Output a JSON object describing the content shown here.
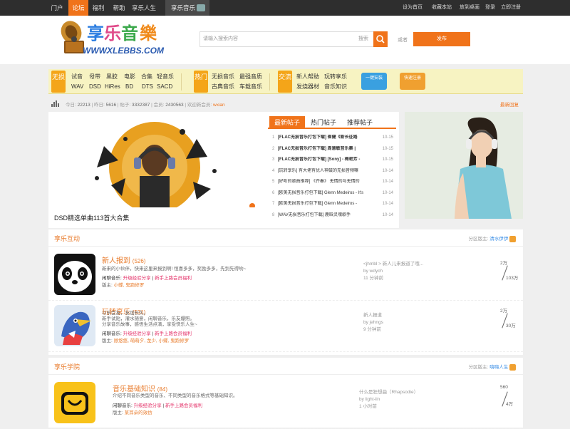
{
  "topnav": {
    "items": [
      "门户",
      "论坛",
      "福利",
      "帮助",
      "享乐人生"
    ],
    "active_index": 1,
    "music_tab": "享乐音乐",
    "right": [
      "设为首页",
      "收藏本站",
      "放到桌面",
      "登录",
      "立即注册"
    ]
  },
  "logo": {
    "cn": "享乐音樂",
    "url": "WWW.XLEBBS.COM"
  },
  "search": {
    "placeholder": "请输入搜索内容",
    "keyword": "搜索",
    "or_text": "或者",
    "post_button": "发布"
  },
  "categories": {
    "group1": {
      "label": "无损",
      "links": [
        "试音",
        "母带",
        "黑胶",
        "电影",
        "合集",
        "轻音乐",
        "WAV",
        "DSD",
        "HiRes",
        "BD",
        "DTS",
        "SACD"
      ]
    },
    "group2": {
      "label": "热门",
      "links": [
        "无损音乐",
        "最强音质",
        "古典音乐",
        "车载音乐"
      ]
    },
    "group3": {
      "label": "交流",
      "links": [
        "新人帮助",
        "玩转享乐",
        "发烧器材",
        "音乐知识"
      ]
    },
    "btn1": "一键安装",
    "btn2": "快速注册"
  },
  "stats": {
    "today_label": "今日:",
    "today": "22213",
    "yesterday_label": "昨日:",
    "yesterday": "5616",
    "posts_label": "帖子:",
    "posts": "3332387",
    "members_label": "会员:",
    "members": "2430563",
    "welcome_label": "欢迎新会员:",
    "welcome_user": "wxian",
    "latest": "最新回复"
  },
  "slider": {
    "caption": "DSD精选单曲113首大合集"
  },
  "hot": {
    "tabs": [
      "最新帖子",
      "热门帖子",
      "推荐帖子"
    ],
    "rows": [
      {
        "n": "1",
        "title": "[FLAC无损音乐打包下载] 崔健《新长征路",
        "date": "10-15",
        "bold": true
      },
      {
        "n": "2",
        "title": "[FLAC无损音乐打包下载] 周慧敏音乐集 |",
        "date": "10-15",
        "bold": true
      },
      {
        "n": "3",
        "title": "[FLAC无损音乐打包下载] [Sony] - 梅艳芳 -",
        "date": "10-15",
        "bold": true
      },
      {
        "n": "4",
        "title": "[玩转享乐] 有大佬有优人神鼓的无损音频嘛",
        "date": "10-14",
        "bold": false
      },
      {
        "n": "5",
        "title": "[好听的歌曲推荐] 《齐秦》 无情的与无情的",
        "date": "10-14",
        "bold": false
      },
      {
        "n": "6",
        "title": "[欧美无损音乐打包下载] Glenn Medeiros - It's",
        "date": "10-14",
        "bold": false
      },
      {
        "n": "7",
        "title": "[欧美无损音乐打包下载] Glenn Medeiros -",
        "date": "10-14",
        "bold": false
      },
      {
        "n": "8",
        "title": "[WAV无损音乐打包下载] 鹿晗灵魂歌手",
        "date": "10-14",
        "bold": false
      }
    ]
  },
  "sections": [
    {
      "title": "享乐互动",
      "mod_label": "分区版主:",
      "mod_name": "清水伊伊",
      "forums": [
        {
          "name": "新人报到",
          "count": "(526)",
          "desc": [
            "新来的小伙伴，快来这里来报到啊! 恒喜多多，奖励多多，先到先得哟~"
          ],
          "idle_label": "闲聊音乐:",
          "idle_a": "升级经验分享",
          "idle_b": "新手上路会员福利",
          "mod_label": "版主:",
          "mods": "小蝶, 鬼跑修罗",
          "last": [
            "<jhmbl > 新人儿来报道了哦...",
            "by wdych",
            "11 分钟前"
          ],
          "num1": "2万",
          "num2": "103万"
        },
        {
          "name": "玩转享乐",
          "count": "(531)",
          "desc": [
            "以乐会友，友谊长久。",
            "新手试贴，灌水随意，闲聊音乐，乐友爆照。",
            "分享音乐故事，感悟生活点滴，享受快乐人生~"
          ],
          "idle_label": "闲聊音乐:",
          "idle_a": "升级经验分享",
          "idle_b": "新手上路会员福利",
          "mod_label": "版主:",
          "mods": "顾悠悠, 萌萌夕, 龙少, 小蝶, 鬼跑修罗",
          "last": [
            "新人报道",
            "by jehngs",
            "9 分钟前"
          ],
          "num1": "2万",
          "num2": "30万"
        }
      ]
    },
    {
      "title": "享乐学院",
      "mod_label": "分区版主:",
      "mod_name": "嗨嗨人生",
      "forums": [
        {
          "name": "音乐基础知识",
          "count": "(84)",
          "desc": [
            "介绍不同音乐类型的音乐、不同类型的音乐格式等基础知识。"
          ],
          "idle_label": "闲聊音乐:",
          "idle_a": "升级经验分享",
          "idle_b": "新手上路会员福利",
          "mod_label": "版主:",
          "mods": "某耳朵的效仿",
          "last": [
            "什么是狂想曲（Rhapsodie）",
            "by light-lin",
            "1 小时前"
          ],
          "num1": "560",
          "num2": "4万"
        }
      ]
    }
  ]
}
